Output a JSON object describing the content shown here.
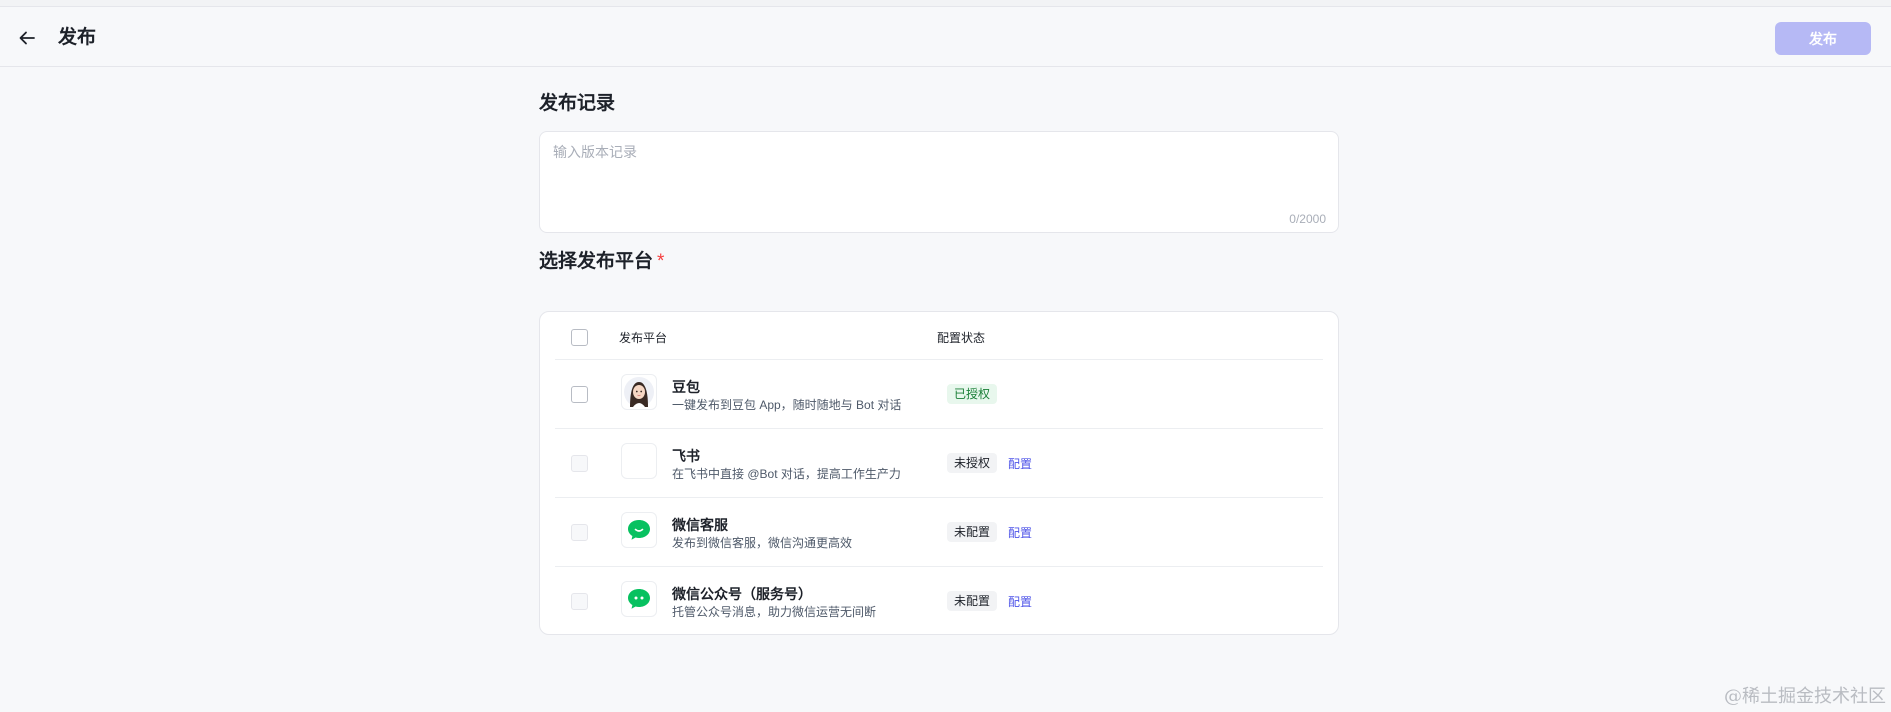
{
  "header": {
    "title": "发布",
    "publish_label": "发布"
  },
  "record": {
    "section_title": "发布记录",
    "placeholder": "输入版本记录",
    "counter": "0/2000"
  },
  "platforms": {
    "section_title": "选择发布平台",
    "required_mark": "*",
    "col_platform": "发布平台",
    "col_status": "配置状态",
    "items": [
      {
        "name": "豆包",
        "desc": "一键发布到豆包 App，随时随地与 Bot 对话",
        "status": "已授权",
        "config": "",
        "icon": "doubao-avatar-icon"
      },
      {
        "name": "飞书",
        "desc": "在飞书中直接 @Bot 对话，提高工作生产力",
        "status": "未授权",
        "config": "配置",
        "icon": "feishu-icon"
      },
      {
        "name": "微信客服",
        "desc": "发布到微信客服，微信沟通更高效",
        "status": "未配置",
        "config": "配置",
        "icon": "wechat-service-icon"
      },
      {
        "name": "微信公众号（服务号）",
        "desc": "托管公众号消息，助力微信运营无间断",
        "status": "未配置",
        "config": "配置",
        "icon": "wechat-official-icon"
      }
    ]
  },
  "watermark": "@稀土掘金技术社区",
  "colors": {
    "accent": "#4d53e8",
    "publish_disabled": "#b6b9f5",
    "authorized_bg": "#e8f7ed",
    "wechat_green": "#07c160"
  }
}
